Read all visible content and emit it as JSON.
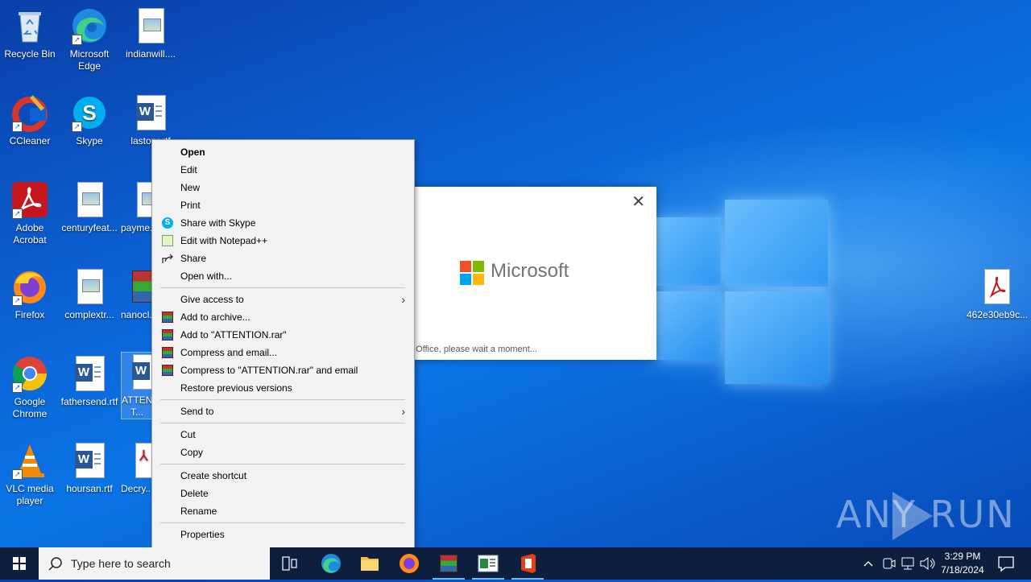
{
  "desktop": {
    "icons": [
      {
        "label": "Recycle Bin"
      },
      {
        "label": "Microsoft Edge"
      },
      {
        "label": "indianwill...."
      },
      {
        "label": "CCleaner"
      },
      {
        "label": "Skype"
      },
      {
        "label": "lastonr.rtf"
      },
      {
        "label": "Adobe Acrobat"
      },
      {
        "label": "centuryfeat..."
      },
      {
        "label": "payme..."
      },
      {
        "label": "Firefox"
      },
      {
        "label": "complextr..."
      },
      {
        "label": "nanocl..."
      },
      {
        "label": "Google Chrome"
      },
      {
        "label": "fathersend.rtf"
      },
      {
        "label": "ATTENT... T..."
      },
      {
        "label": "VLC media player"
      },
      {
        "label": "hoursan.rtf"
      },
      {
        "label": "Decry..."
      },
      {
        "label": "462e30eb9c..."
      }
    ]
  },
  "splash": {
    "brand": "Microsoft",
    "status": "g Office, please wait a moment...",
    "close": "✕"
  },
  "context_menu": {
    "items": [
      {
        "label": "Open"
      },
      {
        "label": "Edit"
      },
      {
        "label": "New"
      },
      {
        "label": "Print"
      },
      {
        "label": "Share with Skype",
        "icon": "skype-icon"
      },
      {
        "label": "Edit with Notepad++",
        "icon": "notepadpp-icon"
      },
      {
        "label": "Share",
        "icon": "share-icon"
      },
      {
        "label": "Open with..."
      },
      {
        "label": "Give access to",
        "submenu": true
      },
      {
        "label": "Add to archive...",
        "icon": "winrar-icon"
      },
      {
        "label": "Add to \"ATTENTION.rar\"",
        "icon": "winrar-icon"
      },
      {
        "label": "Compress and email...",
        "icon": "winrar-icon"
      },
      {
        "label": "Compress to \"ATTENTION.rar\" and email",
        "icon": "winrar-icon"
      },
      {
        "label": "Restore previous versions"
      },
      {
        "label": "Send to",
        "submenu": true
      },
      {
        "label": "Cut"
      },
      {
        "label": "Copy"
      },
      {
        "label": "Create shortcut"
      },
      {
        "label": "Delete"
      },
      {
        "label": "Rename"
      },
      {
        "label": "Properties"
      }
    ],
    "arrow": "›"
  },
  "watermark": {
    "text": "ANY  RUN"
  },
  "taskbar": {
    "search_placeholder": "Type here to search",
    "clock_time": "3:29 PM",
    "clock_date": "7/18/2024"
  },
  "colors": {
    "accent": "#0b63d6",
    "taskbar": "#0d1f3c",
    "menu_bg": "#f2f2f2"
  }
}
